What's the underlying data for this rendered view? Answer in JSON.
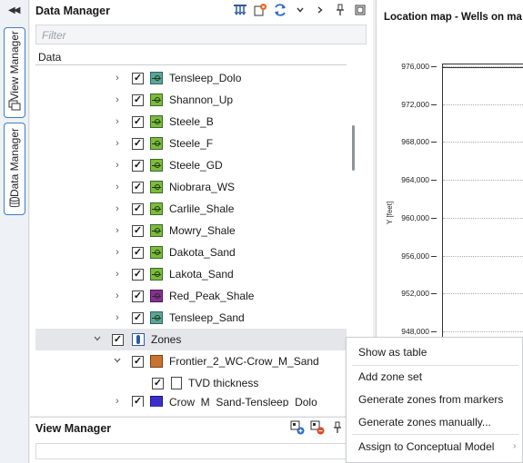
{
  "strip": {
    "tabs": [
      "View Manager",
      "Data Manager"
    ]
  },
  "data_manager": {
    "title": "Data Manager",
    "filter_placeholder": "Filter",
    "column_header": "Data",
    "rows": [
      {
        "label": "Tensleep_Dolo",
        "icon": "teal"
      },
      {
        "label": "Shannon_Up",
        "icon": "green"
      },
      {
        "label": "Steele_B",
        "icon": "green"
      },
      {
        "label": "Steele_F",
        "icon": "green"
      },
      {
        "label": "Steele_GD",
        "icon": "green"
      },
      {
        "label": "Niobrara_WS",
        "icon": "green"
      },
      {
        "label": "Carlile_Shale",
        "icon": "green"
      },
      {
        "label": "Mowry_Shale",
        "icon": "green"
      },
      {
        "label": "Dakota_Sand",
        "icon": "green"
      },
      {
        "label": "Lakota_Sand",
        "icon": "green"
      },
      {
        "label": "Red_Peak_Shale",
        "icon": "purple"
      },
      {
        "label": "Tensleep_Sand",
        "icon": "teal"
      }
    ],
    "zones_label": "Zones",
    "zone_child": "Frontier_2_WC-Crow_M_Sand",
    "zone_grandchild": "TVD thickness",
    "zone_next": "Crow_M_Sand-Tensleep_Dolo"
  },
  "view_manager": {
    "title": "View Manager"
  },
  "map": {
    "title": "Location map - Wells on ma",
    "y_axis_label": "Y [feet]",
    "y_ticks": [
      "976,000",
      "972,000",
      "968,000",
      "964,000",
      "960,000",
      "956,000",
      "952,000",
      "948,000"
    ]
  },
  "context_menu": {
    "items": [
      "Show as table",
      "Add zone set",
      "Generate zones from markers",
      "Generate zones manually...",
      "Assign to Conceptual Model"
    ]
  }
}
